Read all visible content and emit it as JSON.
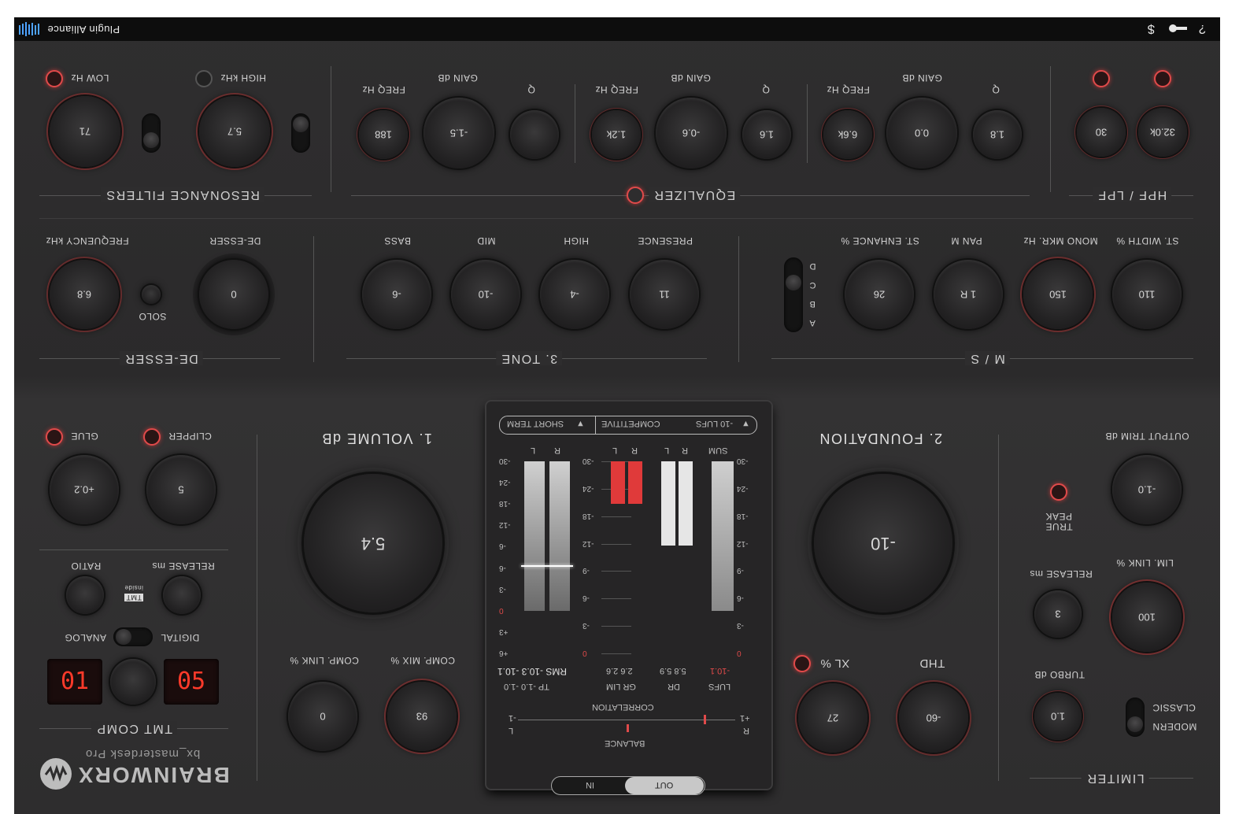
{
  "topbar": {
    "brand": "Plugin Alliance",
    "icons": [
      "plugin-alliance-logo-icon",
      "dollar-icon",
      "key-icon",
      "help-icon"
    ]
  },
  "resonance": {
    "title": "RESONANCE FILTERS",
    "low_label": "LOW Hz",
    "high_label": "HIGH kHz",
    "low_value": "71",
    "high_value": "5.7"
  },
  "equalizer": {
    "title": "EQUALIZER",
    "band1": {
      "freq_label": "FREQ Hz",
      "gain_label": "GAIN dB",
      "q_label": "Q",
      "freq": "188",
      "gain": "-1.5",
      "q": ""
    },
    "band2": {
      "freq_label": "FREQ Hz",
      "gain_label": "GAIN dB",
      "q_label": "Q",
      "freq": "1.2k",
      "gain": "-0.6",
      "q": "1.6"
    },
    "band3": {
      "freq_label": "FREQ Hz",
      "gain_label": "GAIN dB",
      "q_label": "Q",
      "freq": "6.6k",
      "gain": "0.0",
      "q": "1.8"
    }
  },
  "hpflpf": {
    "title": "HPF / LPF",
    "hpf": "30",
    "lpf": "32.0k"
  },
  "deesser": {
    "title": "DE-ESSER",
    "freq_label": "FREQUENCY kHz",
    "amount_label": "DE-ESSER",
    "solo_label": "SOLO",
    "freq": "6.8",
    "amount": "0"
  },
  "tone": {
    "title": "3. TONE",
    "labels": [
      "BASS",
      "MID",
      "HIGH",
      "PRESENCE"
    ],
    "values": [
      "-6",
      "-10",
      "-4",
      "11"
    ]
  },
  "ms": {
    "title": "M / S",
    "labels": [
      "ST. ENHANCE %",
      "PAN M",
      "MONO MKR. Hz",
      "ST. WIDTH %"
    ],
    "values": [
      "26",
      "1 R",
      "150",
      "110"
    ],
    "modes": [
      "D",
      "C",
      "B",
      "A"
    ]
  },
  "comp": {
    "glue_label": "GLUE",
    "clipper_label": "CLIPPER",
    "glue": "+0.2",
    "clipper": "5",
    "ratio_label": "RATIO",
    "release_label": "RELEASE ms",
    "inside_label": "inside",
    "tmt_label": "TMT",
    "analog_label": "ANALOG",
    "digital_label": "DIGITAL",
    "digit_left": "01",
    "digit_right": "05",
    "title": "TMT COMP"
  },
  "volume": {
    "title": "1. VOLUME dB",
    "value": "5.4",
    "comp_link_label": "COMP. LINK %",
    "comp_mix_label": "COMP. MIX %",
    "comp_link": "0",
    "comp_mix": "93"
  },
  "meter": {
    "short_term": "SHORT TERM",
    "preset": "COMPETITIVE",
    "target": "-10 LUFS",
    "col_lr": [
      "L",
      "R"
    ],
    "col_sum": "SUM",
    "scale_left": [
      "-30",
      "-24",
      "-18",
      "-12",
      "-6",
      "-6",
      "-3",
      "0",
      "+3",
      "+6"
    ],
    "scale_mid": [
      "-30",
      "-24",
      "-18",
      "-12",
      "-9",
      "-6",
      "-3",
      "0"
    ],
    "scale_right": [
      "-30",
      "-24",
      "-18",
      "-12",
      "-9",
      "-6",
      "-3",
      "0"
    ],
    "rms": "RMS  -10.3  -10.1",
    "tp": "TP  -1.0  -1.0",
    "gr_vals": "2.6  2.6",
    "gr_label": "GR LIM",
    "dr_vals": "5.8  5.9",
    "dr_label": "DR",
    "lufs_val": "-10.1",
    "lufs_label": "LUFS",
    "correlation": "CORRELATION",
    "balance": "BALANCE",
    "corr_min": "-1",
    "corr_max": "+1",
    "bal_l": "L",
    "bal_r": "R",
    "in": "IN",
    "out": "OUT",
    "levels": {
      "lr_peak": 0.78,
      "lr_rms": 0.54,
      "gr": 0.22,
      "dr": 0.44,
      "sum": 0.78
    }
  },
  "foundation": {
    "title": "2. FOUNDATION",
    "value": "-10",
    "xl_label": "XL %",
    "thd_label": "THD",
    "xl": "27",
    "thd": "-60"
  },
  "limiter": {
    "title": "LIMITER",
    "output_label": "OUTPUT TRIM dB",
    "output": "-1.0",
    "truepeak_label_1": "TRUE",
    "truepeak_label_2": "PEAK",
    "release_label": "RELEASE ms",
    "release": "3",
    "link_label": "LIM. LINK %",
    "link": "100",
    "turbo_label": "TURBO dB",
    "turbo": "1.0",
    "classic_label": "CLASSIC",
    "modern_label": "MODERN"
  },
  "brand": {
    "name": "BRAINWORX",
    "product": "bx_masterdesk Pro"
  },
  "colors": {
    "accent": "#e04a4a",
    "panel": "#2e2d2e"
  }
}
